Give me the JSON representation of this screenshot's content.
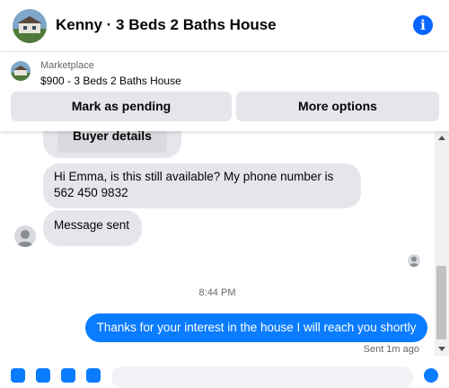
{
  "header": {
    "title": "Kenny · 3 Beds 2 Baths House",
    "info_icon": "info-icon",
    "info_glyph": "i",
    "accent": "#0866ff"
  },
  "listing": {
    "source": "Marketplace",
    "price_title": "$900 - 3 Beds 2 Baths House",
    "buttons": {
      "mark_pending": "Mark as pending",
      "more_options": "More options"
    }
  },
  "messages": {
    "buyer_details": "Buyer details",
    "incoming_1": "Hi Emma, is this still available? My phone number is 562 450 9832",
    "incoming_2": "Message sent",
    "timestamp": "8:44 PM",
    "outgoing_1": "Thanks for your interest in the house I will reach you shortly",
    "outgoing_status": "Sent 1m ago",
    "outgoing_color": "#0a7cff"
  }
}
